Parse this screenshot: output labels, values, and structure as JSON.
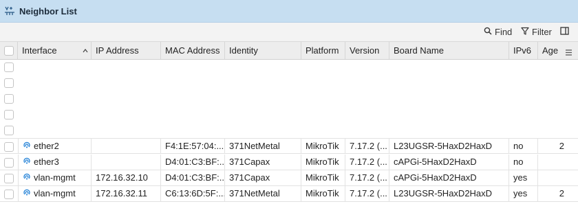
{
  "window": {
    "title": "Neighbor List"
  },
  "toolbar": {
    "find_label": "Find",
    "filter_label": "Filter"
  },
  "columns": [
    {
      "key": "interface",
      "label": "Interface",
      "sort": "asc"
    },
    {
      "key": "ip",
      "label": "IP Address"
    },
    {
      "key": "mac",
      "label": "MAC Address"
    },
    {
      "key": "identity",
      "label": "Identity"
    },
    {
      "key": "platform",
      "label": "Platform"
    },
    {
      "key": "version",
      "label": "Version"
    },
    {
      "key": "board",
      "label": "Board Name"
    },
    {
      "key": "ipv6",
      "label": "IPv6"
    },
    {
      "key": "age",
      "label": "Age"
    }
  ],
  "rows": [
    {
      "interface": "ether2",
      "ip": "",
      "mac": "F4:1E:57:04:...",
      "identity": "371NetMetal",
      "platform": "MikroTik",
      "version": "7.17.2 (...",
      "board": "L23UGSR-5HaxD2HaxD",
      "ipv6": "no",
      "age": "2"
    },
    {
      "interface": "ether3",
      "ip": "",
      "mac": "D4:01:C3:BF:...",
      "identity": "371Capax",
      "platform": "MikroTik",
      "version": "7.17.2 (...",
      "board": "cAPGi-5HaxD2HaxD",
      "ipv6": "no",
      "age": ""
    },
    {
      "interface": "vlan-mgmt",
      "ip": "172.16.32.10",
      "mac": "D4:01:C3:BF:...",
      "identity": "371Capax",
      "platform": "MikroTik",
      "version": "7.17.2 (...",
      "board": "cAPGi-5HaxD2HaxD",
      "ipv6": "yes",
      "age": ""
    },
    {
      "interface": "vlan-mgmt",
      "ip": "172.16.32.11",
      "mac": "C6:13:6D:5F:...",
      "identity": "371NetMetal",
      "platform": "MikroTik",
      "version": "7.17.2 (...",
      "board": "L23UGSR-5HaxD2HaxD",
      "ipv6": "yes",
      "age": "2"
    }
  ],
  "colors": {
    "titlebar_bg": "#c6def1",
    "accent": "#1e7fd6"
  },
  "icons": {
    "title": "network-neighbor-icon",
    "interface": "wireless-signal-icon"
  }
}
